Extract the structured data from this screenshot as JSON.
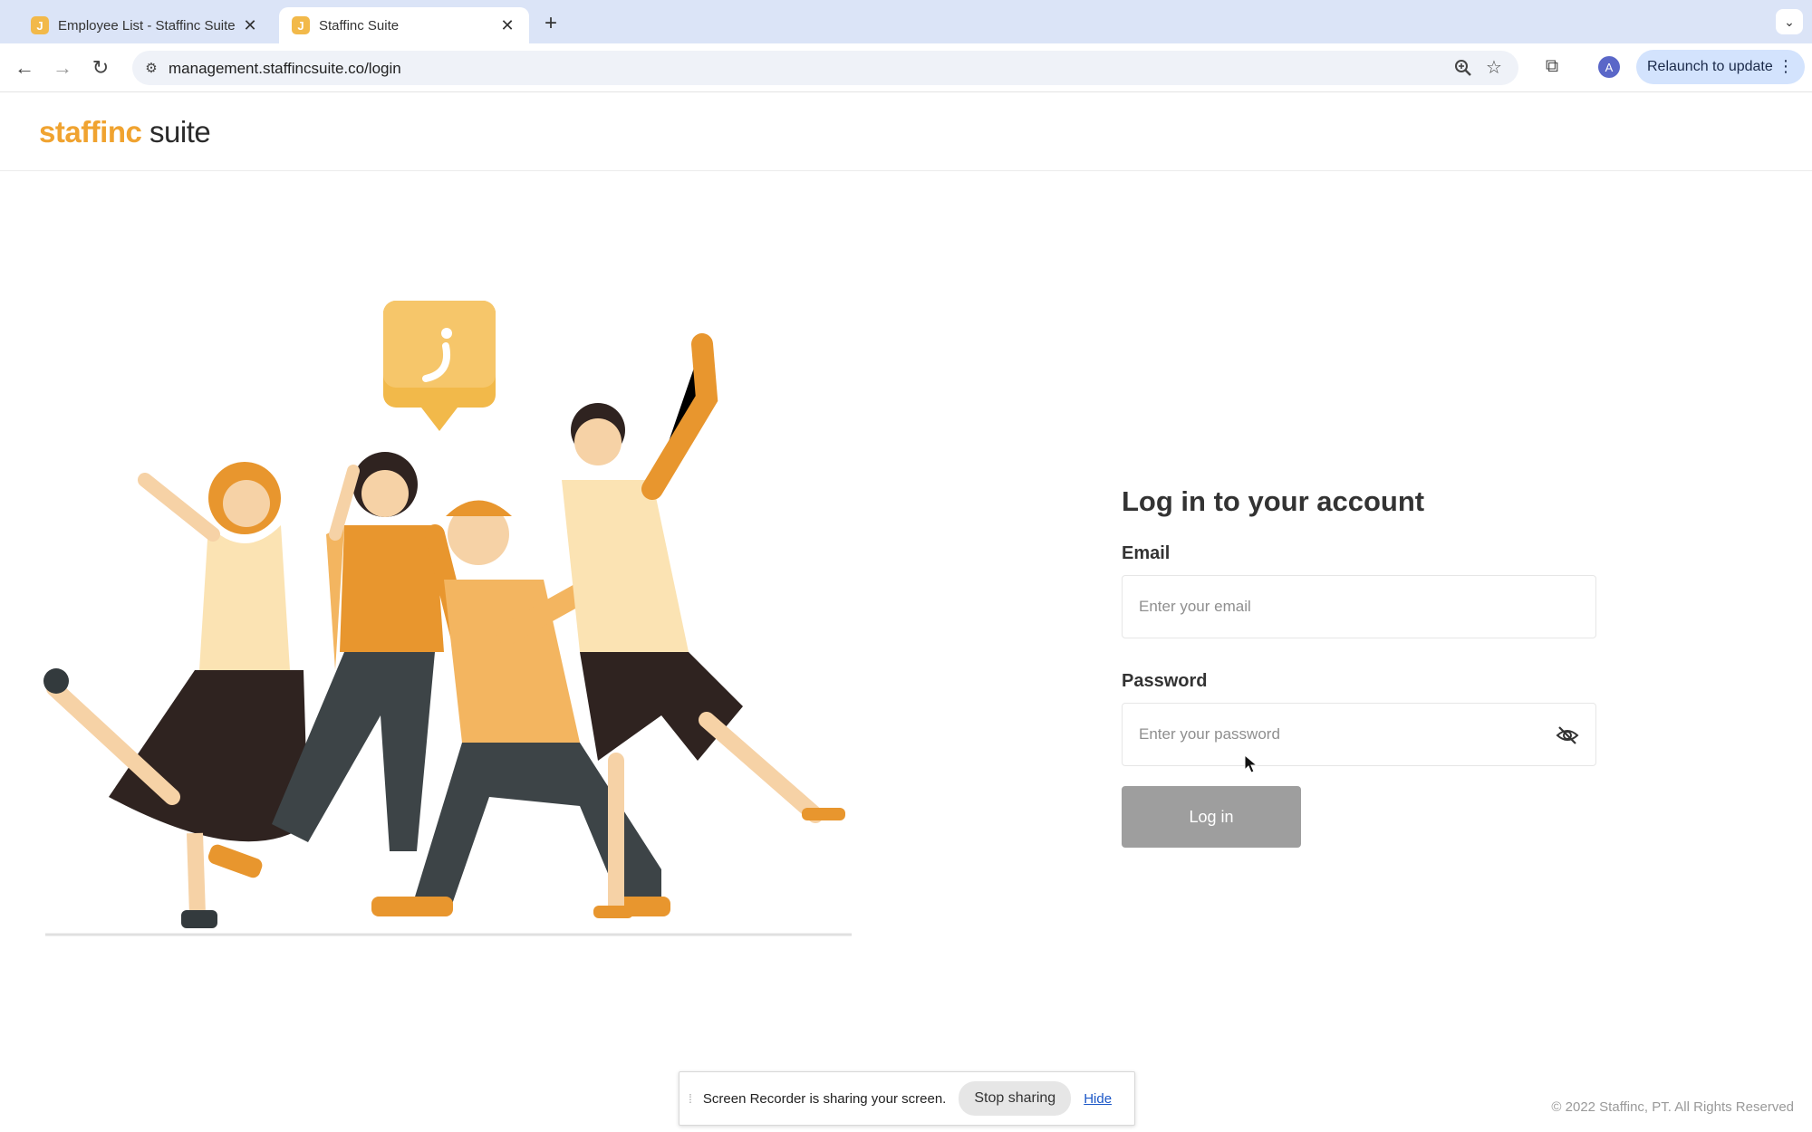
{
  "browser": {
    "tabs": [
      {
        "title": "Employee List - Staffinc Suite",
        "favicon": "J",
        "active": false
      },
      {
        "title": "Staffinc Suite",
        "favicon": "J",
        "active": true
      }
    ],
    "url": "management.staffincsuite.co/login",
    "avatar_letter": "A",
    "relaunch_label": "Relaunch to update"
  },
  "header": {
    "logo_brand": "staffinc",
    "logo_suite": "suite"
  },
  "login": {
    "heading": "Log in to your account",
    "email_label": "Email",
    "email_placeholder": "Enter your email",
    "password_label": "Password",
    "password_placeholder": "Enter your password",
    "submit_label": "Log in"
  },
  "sharing_bar": {
    "message": "Screen Recorder is sharing your screen.",
    "stop_label": "Stop sharing",
    "hide_label": "Hide"
  },
  "footer": {
    "copyright": "© 2022 Staffinc, PT. All Rights Reserved"
  },
  "colors": {
    "brand_orange": "#f0a330",
    "button_disabled": "#9e9e9e",
    "relaunch_bg": "#d3e3fd"
  }
}
